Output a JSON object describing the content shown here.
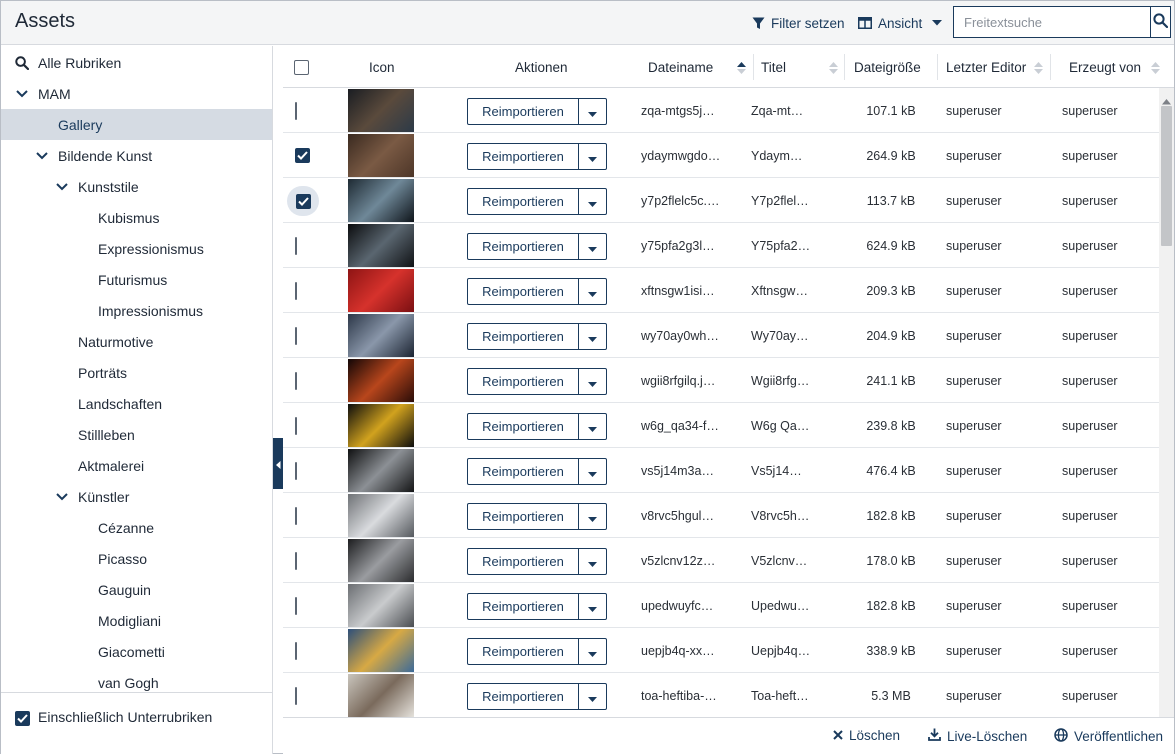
{
  "header": {
    "title": "Assets",
    "filter_label": "Filter setzen",
    "view_label": "Ansicht",
    "search_placeholder": "Freitextsuche"
  },
  "sidebar": {
    "items": [
      {
        "label": "Alle Rubriken",
        "level": 0,
        "icon": "search-icon"
      },
      {
        "label": "MAM",
        "level": 0,
        "icon": "chevron-down-icon"
      },
      {
        "label": "Gallery",
        "level": 1,
        "selected": true
      },
      {
        "label": "Bildende Kunst",
        "level": 1,
        "icon": "chevron-down-icon"
      },
      {
        "label": "Kunststile",
        "level": 2,
        "icon": "chevron-down-icon"
      },
      {
        "label": "Kubismus",
        "level": 3
      },
      {
        "label": "Expressionismus",
        "level": 3
      },
      {
        "label": "Futurismus",
        "level": 3
      },
      {
        "label": "Impressionismus",
        "level": 3
      },
      {
        "label": "Naturmotive",
        "level": 2
      },
      {
        "label": "Porträts",
        "level": 2
      },
      {
        "label": "Landschaften",
        "level": 2
      },
      {
        "label": "Stillleben",
        "level": 2
      },
      {
        "label": "Aktmalerei",
        "level": 2
      },
      {
        "label": "Künstler",
        "level": 2,
        "icon": "chevron-down-icon"
      },
      {
        "label": "Cézanne",
        "level": 3
      },
      {
        "label": "Picasso",
        "level": 3
      },
      {
        "label": "Gauguin",
        "level": 3
      },
      {
        "label": "Modigliani",
        "level": 3
      },
      {
        "label": "Giacometti",
        "level": 3
      },
      {
        "label": "van Gogh",
        "level": 3
      }
    ],
    "footer_checkbox_label": "Einschließlich Unterrubriken",
    "footer_checked": true
  },
  "table": {
    "columns": {
      "icon": "Icon",
      "actions": "Aktionen",
      "filename": "Dateiname",
      "title": "Titel",
      "size": "Dateigröße",
      "editor": "Letzter Editor",
      "creator": "Erzeugt von"
    },
    "action_label": "Reimportieren",
    "rows": [
      {
        "checked": false,
        "filename": "zqa-mtgs5j…",
        "title": "Zqa-mt…",
        "size": "107.1 kB",
        "editor": "superuser",
        "creator": "superuser",
        "thumb": [
          "#1a1d22",
          "#5a4a3c",
          "#2c3a48"
        ]
      },
      {
        "checked": true,
        "filename": "ydaymwgdo…",
        "title": "Ydaym…",
        "size": "264.9 kB",
        "editor": "superuser",
        "creator": "superuser",
        "thumb": [
          "#3a2a20",
          "#7a5a44",
          "#4d3628"
        ]
      },
      {
        "checked": true,
        "halo": true,
        "filename": "y7p2flelc5c.…",
        "title": "Y7p2flel…",
        "size": "113.7 kB",
        "editor": "superuser",
        "creator": "superuser",
        "thumb": [
          "#1e2a33",
          "#6f8898",
          "#0e141a"
        ]
      },
      {
        "checked": false,
        "filename": "y75pfa2g3l…",
        "title": "Y75pfa2…",
        "size": "624.9 kB",
        "editor": "superuser",
        "creator": "superuser",
        "thumb": [
          "#0b0c0e",
          "#5a6670",
          "#101215"
        ]
      },
      {
        "checked": false,
        "filename": "xftnsgw1isi…",
        "title": "Xftnsgw…",
        "size": "209.3 kB",
        "editor": "superuser",
        "creator": "superuser",
        "thumb": [
          "#8e1414",
          "#d6322c",
          "#7a0f12"
        ]
      },
      {
        "checked": false,
        "filename": "wy70ay0wh…",
        "title": "Wy70ay…",
        "size": "204.9 kB",
        "editor": "superuser",
        "creator": "superuser",
        "thumb": [
          "#2c3748",
          "#8a97aa",
          "#1b2432"
        ]
      },
      {
        "checked": false,
        "filename": "wgii8rfgilq.j…",
        "title": "Wgii8rfg…",
        "size": "241.1 kB",
        "editor": "superuser",
        "creator": "superuser",
        "thumb": [
          "#120606",
          "#b8461c",
          "#2a0c08"
        ]
      },
      {
        "checked": false,
        "filename": "w6g_qa34-f…",
        "title": "W6g Qa…",
        "size": "239.8 kB",
        "editor": "superuser",
        "creator": "superuser",
        "thumb": [
          "#0d0d0d",
          "#d1a21e",
          "#0d0d0d"
        ]
      },
      {
        "checked": false,
        "filename": "vs5j14m3a…",
        "title": "Vs5j14…",
        "size": "476.4 kB",
        "editor": "superuser",
        "creator": "superuser",
        "thumb": [
          "#0f1011",
          "#8c9095",
          "#141516"
        ]
      },
      {
        "checked": false,
        "filename": "v8rvc5hgul…",
        "title": "V8rvc5h…",
        "size": "182.8 kB",
        "editor": "superuser",
        "creator": "superuser",
        "thumb": [
          "#6f7276",
          "#d9dbde",
          "#55595e"
        ]
      },
      {
        "checked": false,
        "filename": "v5zlcnv12z…",
        "title": "V5zlcnv…",
        "size": "178.0 kB",
        "editor": "superuser",
        "creator": "superuser",
        "thumb": [
          "#1c1d1f",
          "#9a9ca0",
          "#2b2c2e"
        ]
      },
      {
        "checked": false,
        "filename": "upedwuyfc…",
        "title": "Upedwu…",
        "size": "182.8 kB",
        "editor": "superuser",
        "creator": "superuser",
        "thumb": [
          "#6b6e72",
          "#c9cbcd",
          "#4a4d51"
        ]
      },
      {
        "checked": false,
        "filename": "uepjb4q-xx…",
        "title": "Uepjb4q…",
        "size": "338.9 kB",
        "editor": "superuser",
        "creator": "superuser",
        "thumb": [
          "#2d4f7a",
          "#d7a944",
          "#3c6a99"
        ]
      },
      {
        "checked": false,
        "filename": "toa-heftiba-…",
        "title": "Toa-heft…",
        "size": "5.3 MB",
        "editor": "superuser",
        "creator": "superuser",
        "thumb": [
          "#c9c5bd",
          "#7a6a5c",
          "#e5e2dc"
        ]
      }
    ]
  },
  "footer": {
    "delete_label": "Löschen",
    "live_delete_label": "Live-Löschen",
    "publish_label": "Veröffentlichen"
  },
  "colors": {
    "accent": "#1a3a5c",
    "selected_bg": "#d5dbe3",
    "header_bg": "#f4f5f6"
  }
}
